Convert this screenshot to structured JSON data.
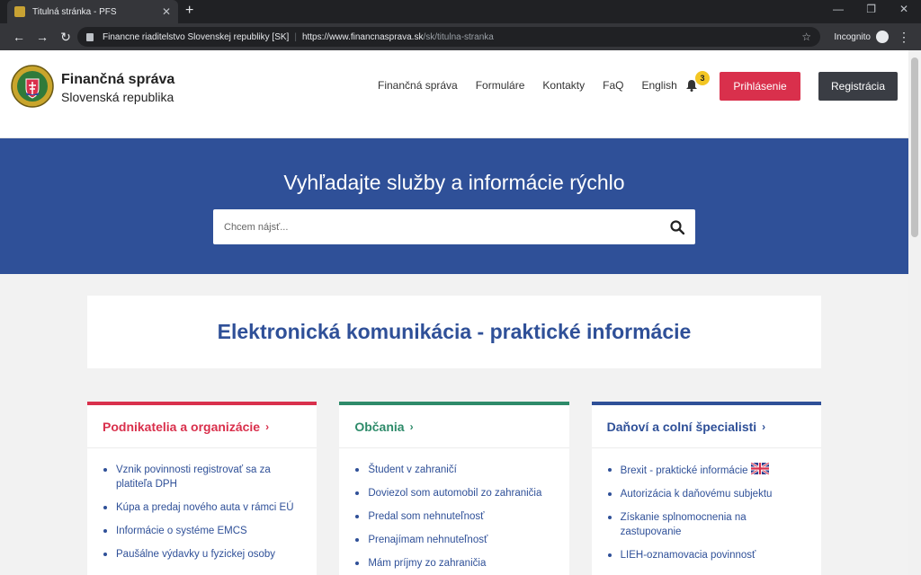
{
  "browser": {
    "tab_title": "Titulná stránka - PFS",
    "site_org": "Financne riaditelstvo Slovenskej republiky [SK]",
    "url_host": "https://www.financnasprava.sk",
    "url_path": "/sk/titulna-stranka",
    "incognito_label": "Incognito"
  },
  "header": {
    "brand_line1": "Finančná správa",
    "brand_line2": "Slovenská republika",
    "nav": [
      "Finančná správa",
      "Formuláre",
      "Kontakty",
      "FaQ",
      "English"
    ],
    "notification_count": "3",
    "login_label": "Prihlásenie",
    "register_label": "Registrácia"
  },
  "hero": {
    "title": "Vyhľadajte služby a informácie rýchlo",
    "search_placeholder": "Chcem nájsť..."
  },
  "info": {
    "title": "Elektronická komunikácia - praktické informácie"
  },
  "cards": [
    {
      "title": "Podnikatelia a organizácie",
      "color": "#d9304c",
      "items": [
        "Vznik povinnosti registrovať sa za platiteľa DPH",
        "Kúpa a predaj nového auta v rámci EÚ",
        "Informácie o systéme EMCS",
        "Paušálne výdavky u fyzickej osoby"
      ]
    },
    {
      "title": "Občania",
      "color": "#2e8b6a",
      "items": [
        "Študent v zahraničí",
        "Doviezol som automobil zo zahraničia",
        "Predal som nehnuteľnosť",
        "Prenajímam nehnuteľnosť",
        "Mám príjmy zo zahraničia"
      ]
    },
    {
      "title": "Daňoví a colní špecialisti",
      "color": "#2f5098",
      "items": [
        "Brexit - praktické informácie",
        "Autorizácia k daňovému subjektu",
        "Získanie splnomocnenia na zastupovanie",
        "LIEH-oznamovacia povinnosť"
      ]
    }
  ]
}
